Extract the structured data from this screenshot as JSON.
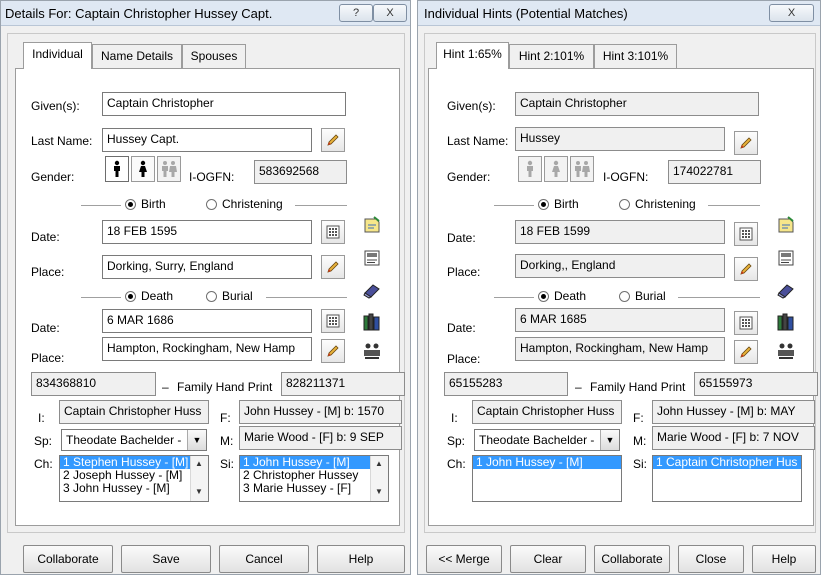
{
  "left": {
    "title": "Details For:  Captain Christopher Hussey Capt.",
    "title_buttons": [
      "?",
      "X"
    ],
    "tabs": [
      "Individual",
      "Name Details",
      "Spouses"
    ],
    "given_label": "Given(s):",
    "given_value": "Captain Christopher",
    "last_label": "Last Name:",
    "last_value": "Hussey Capt.",
    "gender_label": "Gender:",
    "iogfn_label": "I-OGFN:",
    "iogfn_value": "583692568",
    "birth_label": "Birth",
    "christening_label": "Christening",
    "birth_date_label": "Date:",
    "birth_date": "18 FEB 1595",
    "birth_place_label": "Place:",
    "birth_place": "Dorking, Surry, England",
    "death_label": "Death",
    "burial_label": "Burial",
    "death_date_label": "Date:",
    "death_date": "6 MAR 1686",
    "death_place_label": "Place:",
    "death_place": "Hampton, Rockingham, New Hamp",
    "id_left": "834368810",
    "family_hand_print_label": "Family Hand Print",
    "id_right": "828211371",
    "i_label": "I:",
    "i_value": "Captain Christopher Huss",
    "f_label": "F:",
    "f_value": "John Hussey - [M] b: 1570",
    "sp_label": "Sp:",
    "sp_value": "Theodate Bachelder -",
    "m_label": "M:",
    "m_value": "Marie Wood - [F] b: 9 SEP",
    "ch_label": "Ch:",
    "children": [
      "1 Stephen Hussey - [M]",
      "2 Joseph Hussey - [M]",
      "3 John Hussey - [M]"
    ],
    "si_label": "Si:",
    "siblings": [
      "1 John Hussey - [M]",
      "2 Christopher Hussey",
      "3 Marie Hussey - [F]"
    ],
    "buttons": [
      "Collaborate",
      "Save",
      "Cancel",
      "Help"
    ]
  },
  "right": {
    "title": "Individual Hints (Potential Matches)",
    "title_buttons": [
      "X"
    ],
    "tabs": [
      "Hint 1:65%",
      "Hint 2:101%",
      "Hint 3:101%"
    ],
    "given_label": "Given(s):",
    "given_value": "Captain Christopher",
    "last_label": "Last Name:",
    "last_value": "Hussey",
    "gender_label": "Gender:",
    "iogfn_label": "I-OGFN:",
    "iogfn_value": "174022781",
    "birth_label": "Birth",
    "christening_label": "Christening",
    "birth_date_label": "Date:",
    "birth_date": "18 FEB 1599",
    "birth_place_label": "Place:",
    "birth_place": "Dorking,, England",
    "death_label": "Death",
    "burial_label": "Burial",
    "death_date_label": "Date:",
    "death_date": "6 MAR 1685",
    "death_place_label": "Place:",
    "death_place": "Hampton, Rockingham, New Hamp",
    "id_left": "65155283",
    "family_hand_print_label": "Family Hand Print",
    "id_right": "65155973",
    "i_label": "I:",
    "i_value": "Captain Christopher Huss",
    "f_label": "F:",
    "f_value": "John Hussey - [M] b: MAY",
    "sp_label": "Sp:",
    "sp_value": "Theodate Bachelder -",
    "m_label": "M:",
    "m_value": "Marie Wood - [F] b: 7 NOV",
    "ch_label": "Ch:",
    "children": [
      "1 John Hussey - [M]"
    ],
    "si_label": "Si:",
    "siblings": [
      "1 Captain Christopher Hus"
    ],
    "buttons": [
      "<< Merge",
      "Clear",
      "Collaborate",
      "Close",
      "Help"
    ]
  },
  "icons": {
    "pencil": "pencil-icon",
    "calendar": "calendar-icon",
    "male": "male-icon",
    "female": "female-icon",
    "couple": "couple-icon",
    "note": "note-icon",
    "source": "source-icon",
    "eraser": "eraser-icon",
    "books": "books-icon",
    "family": "family-icon"
  },
  "colors": {
    "selection": "#3399ff",
    "pencil_tip": "#d03a1a",
    "pencil_body": "#e8b23a"
  }
}
